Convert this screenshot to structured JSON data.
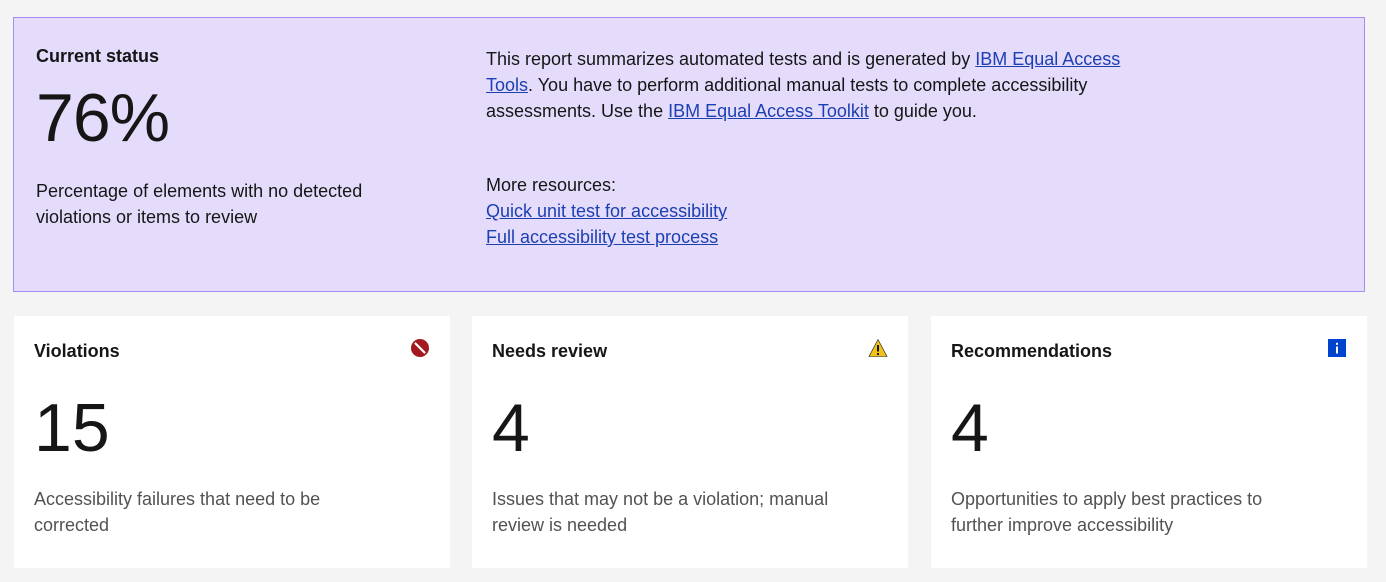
{
  "status": {
    "title": "Current status",
    "percent": "76%",
    "description": "Percentage of elements with no detected violations or items to review",
    "intro_part1": "This report summarizes automated tests and is generated by ",
    "intro_link1": "IBM Equal Access Tools",
    "intro_part2": ". You have to perform additional manual tests to complete accessibility assessments. Use the ",
    "intro_link2": "IBM Equal Access Toolkit",
    "intro_part3": " to guide you.",
    "resources_label": "More resources:",
    "resource_links": [
      "Quick unit test for accessibility",
      "Full accessibility test process"
    ]
  },
  "cards": {
    "violations": {
      "title": "Violations",
      "count": "15",
      "description": "Accessibility failures that need to be corrected",
      "icon": "violation-icon",
      "color": "#a2191f"
    },
    "review": {
      "title": "Needs review",
      "count": "4",
      "description": "Issues that may not be a violation; manual review is needed",
      "icon": "warning-icon",
      "color": "#f1c21b"
    },
    "recommendations": {
      "title": "Recommendations",
      "count": "4",
      "description": "Opportunities to apply best practices to further improve accessibility",
      "icon": "info-icon",
      "color": "#0043ce"
    }
  },
  "colors": {
    "panel_bg": "#e5dcfc",
    "panel_border": "#a58cf5",
    "link": "#1c3fb3"
  }
}
